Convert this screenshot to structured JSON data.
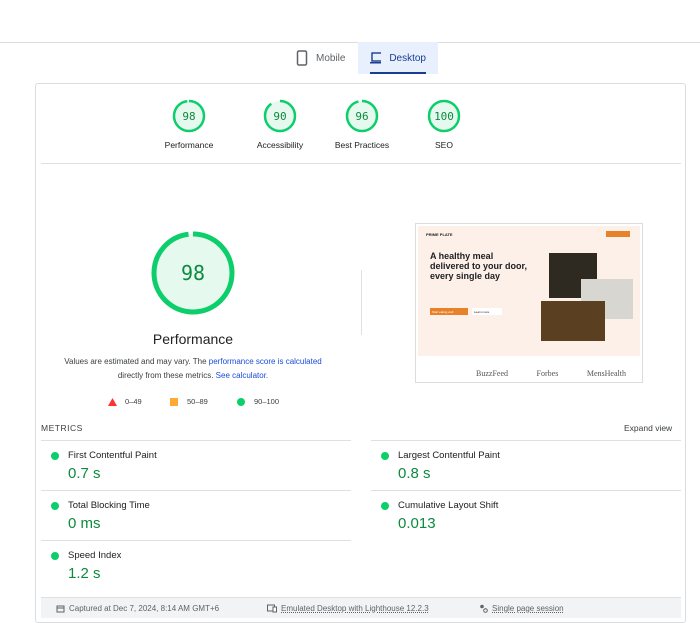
{
  "tabs": [
    {
      "label": "Mobile",
      "icon": "phone-icon"
    },
    {
      "label": "Desktop",
      "icon": "laptop-icon",
      "active": true
    }
  ],
  "scores": [
    {
      "label": "Performance",
      "value": 98
    },
    {
      "label": "Accessibility",
      "value": 90
    },
    {
      "label": "Best Practices",
      "value": 96
    },
    {
      "label": "SEO",
      "value": 100
    }
  ],
  "main": {
    "score": 98,
    "title": "Performance",
    "note_1": "Values are estimated and may vary. The ",
    "note_link1": "performance score is calculated",
    "note_2": "directly from these metrics. ",
    "note_link2": "See calculator."
  },
  "legend": [
    {
      "range": "0–49",
      "color": "#ff3333"
    },
    {
      "range": "50–89",
      "color": "#ffaa33"
    },
    {
      "range": "90–100",
      "color": "#0cce6b"
    }
  ],
  "preview": {
    "brand": "PRIME PLATE",
    "headline": "A healthy meal delivered to your door, every single day",
    "cta": "Start eating well",
    "secondary": "Learn more",
    "logos": [
      "BuzzFeed",
      "Forbes",
      "MensHealth"
    ]
  },
  "metrics": {
    "heading": "METRICS",
    "expand": "Expand view",
    "items": [
      {
        "name": "First Contentful Paint",
        "value": "0.7 s"
      },
      {
        "name": "Largest Contentful Paint",
        "value": "0.8 s"
      },
      {
        "name": "Total Blocking Time",
        "value": "0 ms"
      },
      {
        "name": "Cumulative Layout Shift",
        "value": "0.013"
      },
      {
        "name": "Speed Index",
        "value": "1.2 s"
      }
    ]
  },
  "footer": {
    "captured": "Captured at Dec 7, 2024, 8:14 AM GMT+6",
    "emulated": "Emulated Desktop with Lighthouse 12.2.3",
    "session": "Single page session"
  },
  "colors": {
    "pass": "#0cce6b",
    "accent": "#1a3d8f"
  }
}
